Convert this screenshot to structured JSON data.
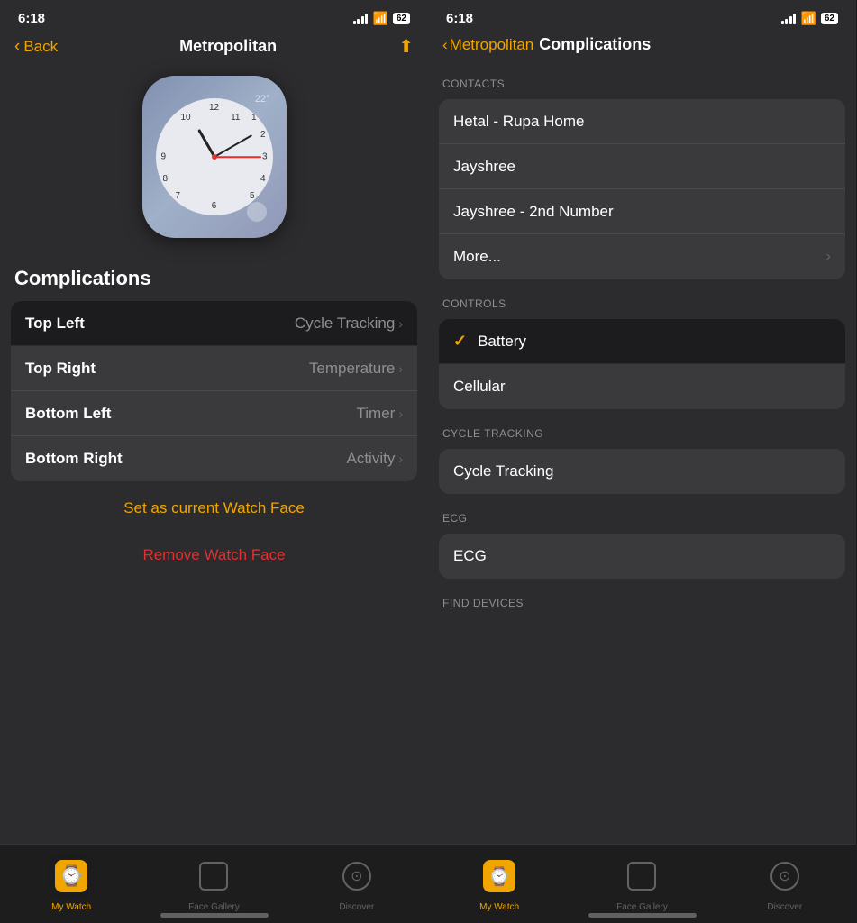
{
  "left_panel": {
    "status": {
      "time": "6:18",
      "battery": "62"
    },
    "nav": {
      "back_label": "Back",
      "title": "Metropolitan",
      "share_icon": "⬆"
    },
    "watch_face": {
      "temp": "22°"
    },
    "section_title": "Complications",
    "complications": [
      {
        "label": "Top Left",
        "value": "Cycle Tracking",
        "selected": true
      },
      {
        "label": "Top Right",
        "value": "Temperature"
      },
      {
        "label": "Bottom Left",
        "value": "Timer"
      },
      {
        "label": "Bottom Right",
        "value": "Activity"
      }
    ],
    "set_watch_face_label": "Set as current Watch Face",
    "remove_watch_face_label": "Remove Watch Face"
  },
  "right_panel": {
    "status": {
      "time": "6:18",
      "battery": "62"
    },
    "nav": {
      "back_label": "Metropolitan",
      "title": "Complications"
    },
    "sections": [
      {
        "header": "CONTACTS",
        "items": [
          {
            "label": "Hetal - Rupa Home"
          },
          {
            "label": "Jayshree"
          },
          {
            "label": "Jayshree - 2nd Number"
          },
          {
            "label": "More...",
            "has_chevron": true
          }
        ]
      },
      {
        "header": "CONTROLS",
        "items": [
          {
            "label": "Battery",
            "selected": true
          },
          {
            "label": "Cellular"
          }
        ]
      },
      {
        "header": "CYCLE TRACKING",
        "items": [
          {
            "label": "Cycle Tracking"
          }
        ]
      },
      {
        "header": "ECG",
        "items": [
          {
            "label": "ECG"
          }
        ]
      },
      {
        "header": "FIND DEVICES",
        "items": []
      }
    ]
  },
  "tab_bar": {
    "items": [
      {
        "label": "My Watch",
        "active": true
      },
      {
        "label": "Face Gallery",
        "active": false
      },
      {
        "label": "Discover",
        "active": false
      }
    ]
  }
}
